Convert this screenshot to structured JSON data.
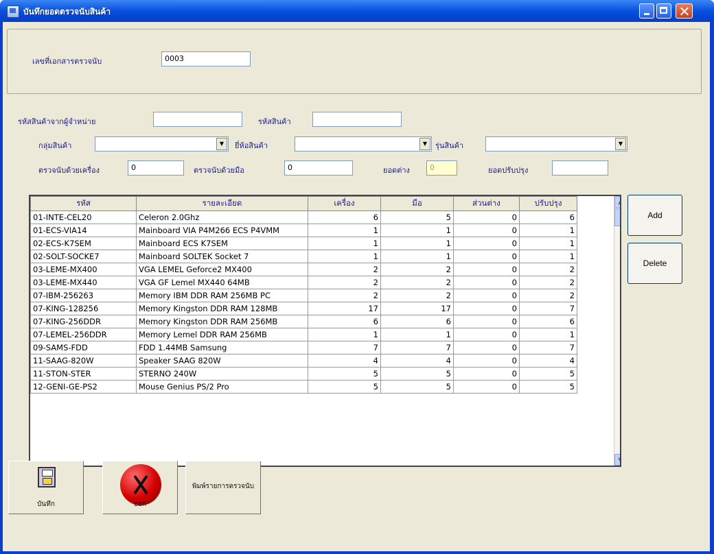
{
  "window": {
    "title": "บันทึกยอดตรวจนับสินค้า"
  },
  "header": {
    "doc_no_label": "เลขที่เอกสารตรวจนับ",
    "doc_no_value": "0003"
  },
  "filters": {
    "vendor_code_label": "รหัสสินค้าจากผู้จำหน่าย",
    "vendor_code_value": "",
    "product_code_label": "รหัสสินค้า",
    "product_code_value": "",
    "category_label": "กลุ่มสินค้า",
    "category_value": "",
    "brand_label": "ยี่ห้อสินค้า",
    "brand_value": "",
    "model_label": "รุ่นสินค้า",
    "model_value": "",
    "counted_label": "ตรวจนับด้วยเครื่อง",
    "counted_value": "0",
    "manual_label": "ตรวจนับด้วยมือ",
    "manual_value": "0",
    "balance_label": "ยอดต่าง",
    "balance_value": "0",
    "adjust_label": "ยอดปรับปรุง",
    "adjust_value": ""
  },
  "grid": {
    "columns": [
      "รหัส",
      "รายละเอียด",
      "เครื่อง",
      "มือ",
      "ส่วนต่าง",
      "ปรับปรุง"
    ],
    "rows": [
      [
        "01-INTE-CEL20",
        "Celeron 2.0Ghz",
        "6",
        "5",
        "0",
        "6"
      ],
      [
        "01-ECS-VIA14",
        "Mainboard VIA P4M266 ECS P4VMM",
        "1",
        "1",
        "0",
        "1"
      ],
      [
        "02-ECS-K7SEM",
        "Mainboard ECS K7SEM",
        "1",
        "1",
        "0",
        "1"
      ],
      [
        "02-SOLT-SOCKE7",
        "Mainboard SOLTEK Socket 7",
        "1",
        "1",
        "0",
        "1"
      ],
      [
        "03-LEME-MX400",
        "VGA LEMEL Geforce2 MX400",
        "2",
        "2",
        "0",
        "2"
      ],
      [
        "03-LEME-MX440",
        "VGA GF Lemel MX440 64MB",
        "2",
        "2",
        "0",
        "2"
      ],
      [
        "07-IBM-256263",
        "Memory IBM DDR RAM 256MB PC",
        "2",
        "2",
        "0",
        "2"
      ],
      [
        "07-KING-128256",
        "Memory Kingston DDR RAM 128MB",
        "17",
        "17",
        "0",
        "7"
      ],
      [
        "07-KING-256DDR",
        "Memory Kingston DDR RAM 256MB",
        "6",
        "6",
        "0",
        "6"
      ],
      [
        "07-LEMEL-256DDR",
        "Memory Lemel DDR RAM 256MB",
        "1",
        "1",
        "0",
        "1"
      ],
      [
        "09-SAMS-FDD",
        "FDD 1.44MB Samsung",
        "7",
        "7",
        "0",
        "7"
      ],
      [
        "11-SAAG-820W",
        "Speaker SAAG 820W",
        "4",
        "4",
        "0",
        "4"
      ],
      [
        "11-STON-STER",
        "STERNO 240W",
        "5",
        "5",
        "0",
        "5"
      ],
      [
        "12-GENI-GE-PS2",
        "Mouse Genius PS/2 Pro",
        "5",
        "5",
        "0",
        "5"
      ]
    ]
  },
  "buttons": {
    "add": "Add",
    "delete": "Delete",
    "save": "บันทึก",
    "exit": "ออก",
    "print": "พิมพ์รายการตรวจนับ"
  }
}
